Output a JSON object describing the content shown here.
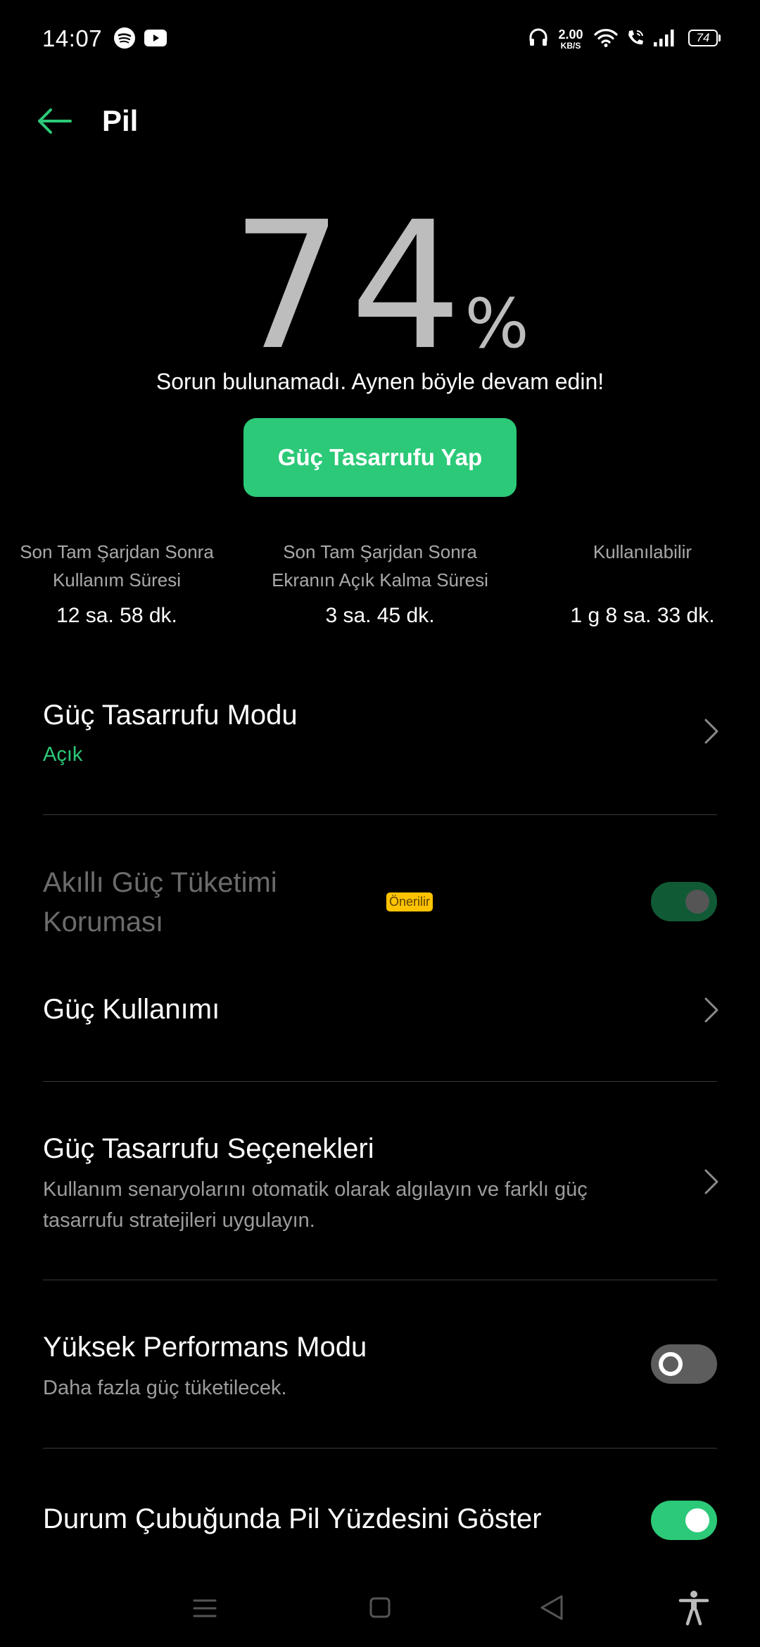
{
  "status_bar": {
    "time": "14:07",
    "net_rate": "2.00",
    "net_unit": "KB/S",
    "battery_level": "74",
    "icons": [
      "spotify-icon",
      "youtube-icon",
      "headphone-icon",
      "wifi-icon",
      "wifi-call-icon",
      "signal-icon",
      "battery-icon"
    ]
  },
  "header": {
    "title": "Pil",
    "back_icon": "back-arrow-icon"
  },
  "battery": {
    "value": "74",
    "unit": "%",
    "message": "Sorun bulunamadı. Aynen böyle devam edin!"
  },
  "save_button": {
    "label": "Güç Tasarrufu Yap"
  },
  "stats": [
    {
      "label_line1": "Son Tam Şarjdan Sonra",
      "label_line2": "Kullanım Süresi",
      "value": "12 sa. 58 dk."
    },
    {
      "label_line1": "Son Tam Şarjdan Sonra",
      "label_line2": "Ekranın Açık Kalma Süresi",
      "value": "3 sa. 45 dk."
    },
    {
      "label_line1": "Kullanılabilir",
      "label_line2": "",
      "value": "1 g 8 sa. 33 dk."
    }
  ],
  "settings": {
    "power_saving_mode": {
      "title": "Güç Tasarrufu Modu",
      "status": "Açık"
    },
    "smart_protection": {
      "title_line1": "Akıllı Güç Tüketimi",
      "title_line2": "Koruması",
      "badge": "Önerilir",
      "enabled": true
    },
    "power_usage": {
      "title": "Güç Kullanımı"
    },
    "power_saving_options": {
      "title": "Güç Tasarrufu Seçenekleri",
      "subtitle_line1": "Kullanım senaryolarını otomatik olarak algılayın ve farklı güç",
      "subtitle_line2": "tasarrufu stratejileri uygulayın."
    },
    "high_performance": {
      "title": "Yüksek Performans Modu",
      "subtitle": "Daha fazla güç tüketilecek.",
      "enabled": false
    },
    "show_battery_percent": {
      "title": "Durum Çubuğunda Pil Yüzdesini Göster",
      "enabled": true
    }
  },
  "colors": {
    "accent": "#2cc978",
    "background": "#000000",
    "badge": "#ffc300"
  },
  "nav_bar": {
    "icons": [
      "menu-icon",
      "home-icon",
      "back-icon",
      "accessibility-icon"
    ]
  }
}
